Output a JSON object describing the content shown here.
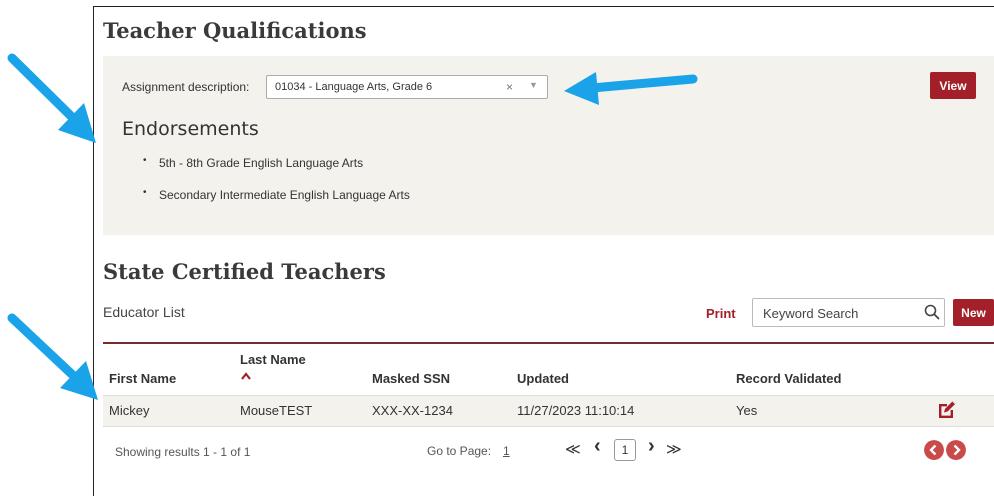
{
  "qualifications": {
    "title": "Teacher Qualifications",
    "assignment_label": "Assignment description:",
    "assignment_value": "01034 - Language Arts, Grade 6",
    "clear_glyph": "×",
    "caret_glyph": "▼",
    "view_label": "View",
    "endorsements_title": "Endorsements",
    "endorsements": [
      "5th - 8th Grade English Language Arts",
      "Secondary Intermediate English Language Arts"
    ]
  },
  "certified": {
    "title": "State Certified Teachers",
    "list_label": "Educator List",
    "print_label": "Print",
    "search_placeholder": "Keyword Search",
    "new_label": "New",
    "columns": [
      "First Name",
      "Last Name",
      "Masked SSN",
      "Updated",
      "Record Validated"
    ],
    "sorted_column": "Last Name",
    "rows": [
      {
        "first_name": "Mickey",
        "last_name": "MouseTEST",
        "ssn": "XXX-XX-1234",
        "updated": "11/27/2023 11:10:14",
        "validated": "Yes"
      }
    ]
  },
  "pagination": {
    "summary": "Showing results 1 - 1 of 1",
    "goto_label": "Go to Page:",
    "goto_value": "1",
    "first_glyph": "≪",
    "prev_glyph": "‹",
    "current_page": "1",
    "next_glyph": "›",
    "last_glyph": "≫"
  },
  "icons": {
    "arrows": "callout-arrow",
    "edit": "edit-icon",
    "search": "search-icon",
    "sort": "sort-ascending-icon"
  },
  "colors": {
    "brand_red": "#a3202a",
    "panel_bg": "#f4f2ec",
    "callout_arrow": "#1aa3e8",
    "nav_circle": "#c94a48"
  }
}
